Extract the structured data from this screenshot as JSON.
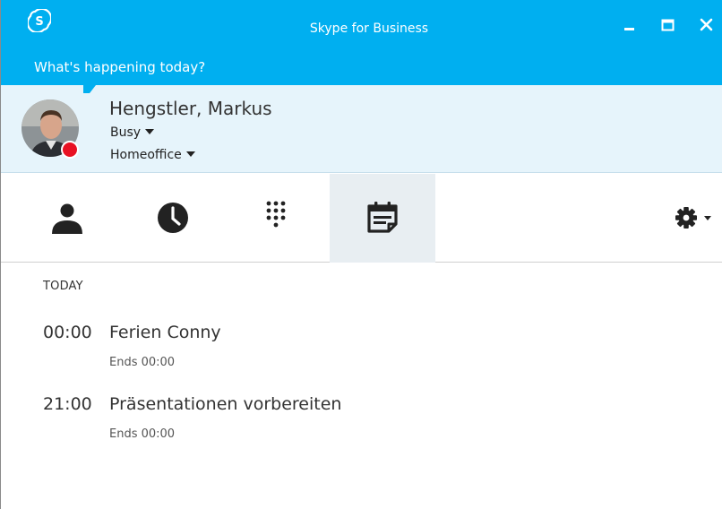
{
  "window": {
    "title": "Skype for Business",
    "icons": {
      "app": "skype-logo-icon",
      "minimize": "minimize-icon",
      "maximize": "maximize-icon",
      "close": "close-icon"
    }
  },
  "profile": {
    "mood_text": "What's happening today?",
    "name": "Hengstler, Markus",
    "status": "Busy",
    "location": "Homeoffice",
    "presence_color": "#e81123"
  },
  "tabs": [
    {
      "id": "contacts",
      "icon": "person-icon",
      "selected": false
    },
    {
      "id": "conversations",
      "icon": "clock-icon",
      "selected": false
    },
    {
      "id": "phone",
      "icon": "dialpad-icon",
      "selected": false
    },
    {
      "id": "meetings",
      "icon": "calendar-icon",
      "selected": true
    }
  ],
  "settings": {
    "icon": "gear-icon"
  },
  "meetings": {
    "section_label": "TODAY",
    "items": [
      {
        "time": "00:00",
        "title": "Ferien Conny",
        "ends": "Ends 00:00"
      },
      {
        "time": "21:00",
        "title": "Präsentationen vorbereiten",
        "ends": "Ends 00:00"
      }
    ]
  },
  "colors": {
    "accent": "#00aff0",
    "profile_bg": "#e6f4fb",
    "selected_tab_bg": "#e8eef2"
  }
}
